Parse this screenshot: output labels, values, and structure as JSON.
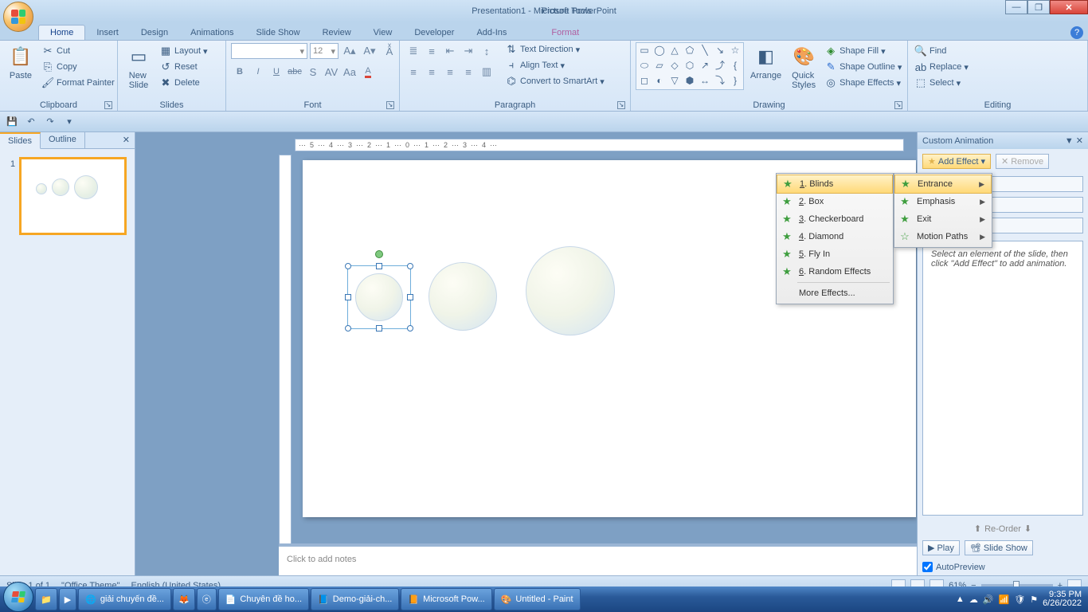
{
  "title": "Presentation1 - Microsoft PowerPoint",
  "contextual_group": "Picture Tools",
  "tabs": [
    "Home",
    "Insert",
    "Design",
    "Animations",
    "Slide Show",
    "Review",
    "View",
    "Developer",
    "Add-Ins",
    "Format"
  ],
  "clipboard": {
    "label": "Clipboard",
    "paste": "Paste",
    "cut": "Cut",
    "copy": "Copy",
    "painter": "Format Painter"
  },
  "slides": {
    "label": "Slides",
    "new": "New\nSlide",
    "layout": "Layout",
    "reset": "Reset",
    "delete": "Delete"
  },
  "font": {
    "label": "Font",
    "size": "12"
  },
  "paragraph": {
    "label": "Paragraph",
    "textdir": "Text Direction",
    "align": "Align Text",
    "smartart": "Convert to SmartArt"
  },
  "drawing": {
    "label": "Drawing",
    "arrange": "Arrange",
    "quick": "Quick\nStyles",
    "fill": "Shape Fill",
    "outline": "Shape Outline",
    "effects": "Shape Effects"
  },
  "editing": {
    "label": "Editing",
    "find": "Find",
    "replace": "Replace",
    "select": "Select"
  },
  "leftpanel": {
    "slides": "Slides",
    "outline": "Outline"
  },
  "notes_placeholder": "Click to add notes",
  "animpanel": {
    "title": "Custom Animation",
    "add": "Add Effect",
    "remove": "Remove",
    "hint": "Select an element of the slide, then click \"Add Effect\" to add animation.",
    "reorder": "Re-Order",
    "play": "Play",
    "slideshow": "Slide Show",
    "autoprev": "AutoPreview"
  },
  "effects_menu": {
    "items": [
      "Blinds",
      "Box",
      "Checkerboard",
      "Diamond",
      "Fly In",
      "Random Effects"
    ],
    "more": "More Effects..."
  },
  "cats_menu": [
    "Entrance",
    "Emphasis",
    "Exit",
    "Motion Paths"
  ],
  "status": {
    "slide": "Slide 1 of 1",
    "theme": "\"Office Theme\"",
    "lang": "English (United States)",
    "zoom": "61%"
  },
  "taskbar": {
    "items": [
      "giải chuyến đề...",
      "",
      "",
      "Chuyên đề ho...",
      "Demo-giải-ch...",
      "Microsoft Pow...",
      "Untitled - Paint"
    ],
    "time": "9:35 PM",
    "date": "6/26/2022"
  }
}
